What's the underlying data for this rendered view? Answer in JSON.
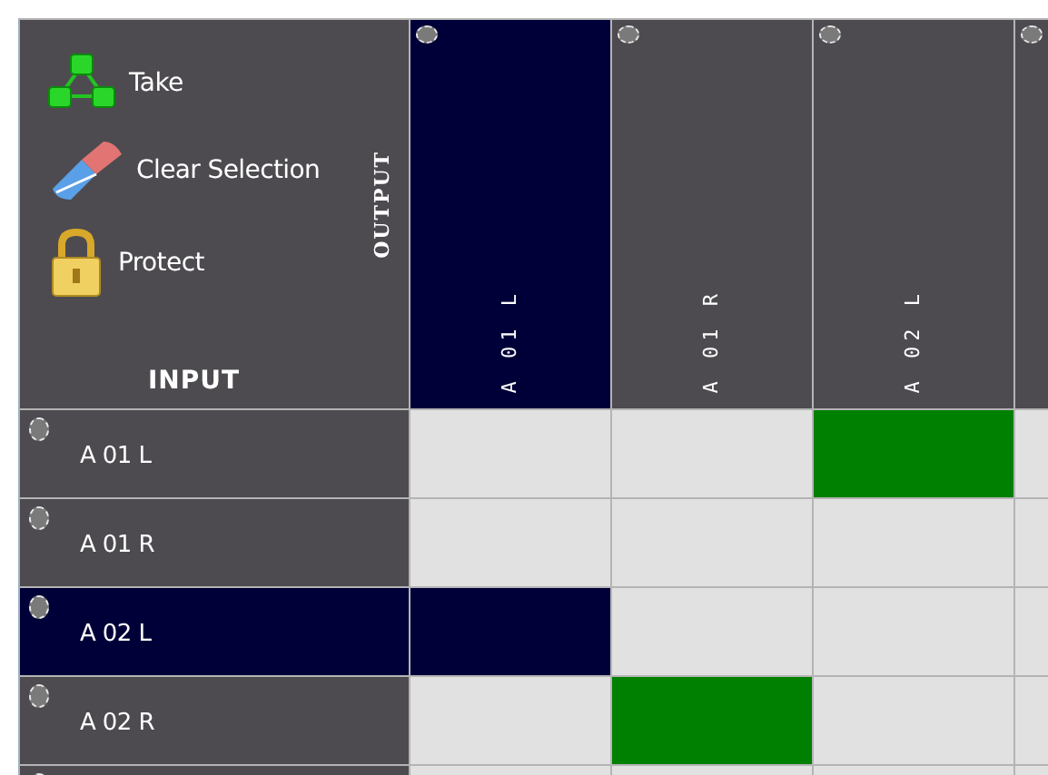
{
  "actions": [
    {
      "kind": "take",
      "label": "Take"
    },
    {
      "kind": "clear",
      "label": "Clear Selection"
    },
    {
      "kind": "protect",
      "label": "Protect"
    }
  ],
  "output_heading": "OUTPUT",
  "input_heading": "INPUT",
  "outputs": [
    {
      "label": "A 01 L",
      "selected": true
    },
    {
      "label": "A 01 R",
      "selected": false
    },
    {
      "label": "A 02 L",
      "selected": false
    },
    {
      "selected": false
    }
  ],
  "inputs": [
    {
      "label": "A 01 L",
      "selected": false,
      "connections": [
        false,
        false,
        true,
        false
      ]
    },
    {
      "label": "A 01 R",
      "selected": false,
      "connections": [
        false,
        false,
        false,
        false
      ]
    },
    {
      "label": "A 02 L",
      "selected": true,
      "connections": [
        false,
        false,
        false,
        false
      ]
    },
    {
      "label": "A 02 R",
      "selected": false,
      "connections": [
        false,
        true,
        false,
        false
      ]
    },
    {
      "selected": false,
      "connections": [
        false,
        false,
        false,
        false
      ]
    }
  ]
}
